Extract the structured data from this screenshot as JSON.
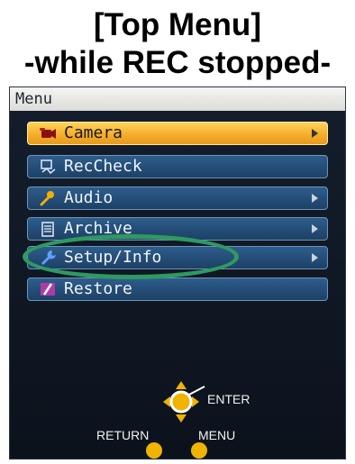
{
  "heading": {
    "line1": "[Top Menu]",
    "line2": "-while REC stopped-"
  },
  "screen": {
    "menu_title": "Menu",
    "items": [
      {
        "label": "Camera",
        "icon": "camera-icon",
        "has_submenu": true,
        "selected": true
      },
      {
        "label": "RecCheck",
        "icon": "reccheck-icon",
        "has_submenu": false,
        "selected": false
      },
      {
        "label": "Audio",
        "icon": "microphone-icon",
        "has_submenu": true,
        "selected": false
      },
      {
        "label": "Archive",
        "icon": "archive-icon",
        "has_submenu": true,
        "selected": false
      },
      {
        "label": "Setup/Info",
        "icon": "wrench-icon",
        "has_submenu": true,
        "selected": false
      },
      {
        "label": "Restore",
        "icon": "restore-icon",
        "has_submenu": false,
        "selected": false
      }
    ],
    "controls": {
      "enter_label": "ENTER",
      "return_label": "RETURN",
      "menu_label": "MENU"
    }
  },
  "colors": {
    "selected_item": "#f3ac2a",
    "item_background": "#244d77",
    "highlight_oval": "#2e9a62",
    "button_dot": "#f0b400"
  }
}
